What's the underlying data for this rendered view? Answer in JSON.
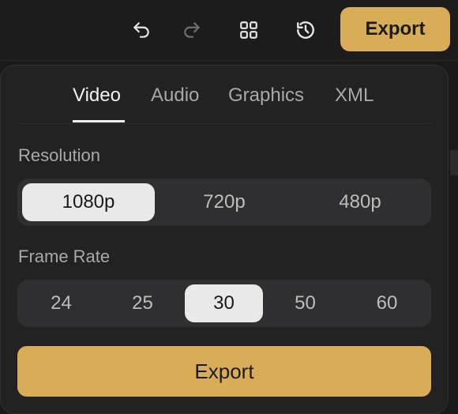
{
  "toolbar": {
    "icons": [
      "undo-icon",
      "redo-icon",
      "grid-icon",
      "history-icon"
    ],
    "export_label": "Export"
  },
  "panel": {
    "tabs": [
      {
        "label": "Video",
        "active": true
      },
      {
        "label": "Audio",
        "active": false
      },
      {
        "label": "Graphics",
        "active": false
      },
      {
        "label": "XML",
        "active": false
      }
    ],
    "resolution": {
      "label": "Resolution",
      "options": [
        "1080p",
        "720p",
        "480p"
      ],
      "selected": "1080p"
    },
    "frame_rate": {
      "label": "Frame Rate",
      "options": [
        "24",
        "25",
        "30",
        "50",
        "60"
      ],
      "selected": "30"
    },
    "export_label": "Export"
  },
  "colors": {
    "accent": "#d9ad57",
    "panel_bg": "#222223",
    "selected_bg": "#e9e9e9"
  }
}
